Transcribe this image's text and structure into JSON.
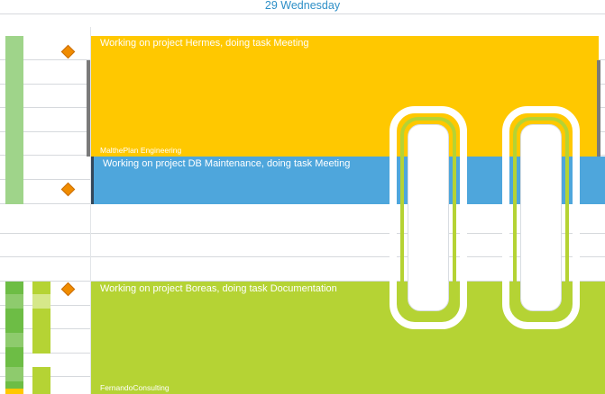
{
  "header": {
    "day_label": "29 Wednesday"
  },
  "appointments": [
    {
      "title": "Working on project Hermes, doing task Meeting",
      "company": "MalthePlan Engineering",
      "color": "#ffc800"
    },
    {
      "title": "Working on project DB Maintenance, doing task Meeting",
      "company": "",
      "color": "#4ea6dc"
    },
    {
      "title": "Working on project Boreas, doing task Documentation",
      "company": "FernandoConsulting",
      "color": "#b5d334"
    }
  ],
  "colors": {
    "header_text": "#2e8fc7",
    "grid_line": "#d6d9dd",
    "stripe_green_light": "#9fd48a",
    "stripe_green": "#6dbd45",
    "stripe_lime": "#b5d334",
    "stripe_orange": "#ffc800",
    "marker_orange": "#f08c00"
  },
  "icons": {
    "marker": "diamond-marker",
    "drag_clip": "paperclip-drag-handle"
  }
}
